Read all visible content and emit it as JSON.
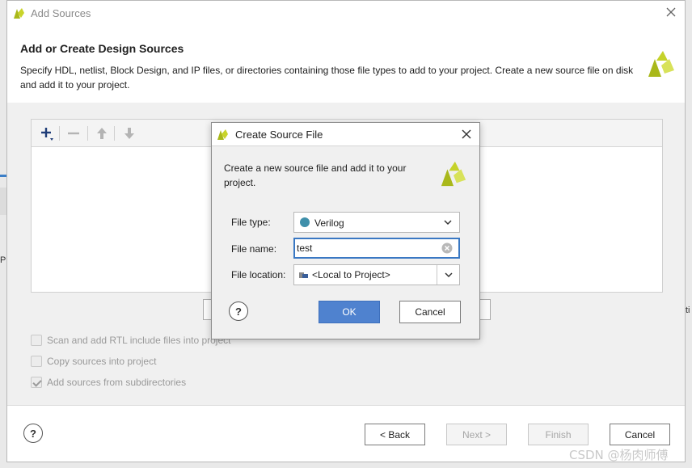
{
  "window": {
    "title": "Add Sources",
    "heading": "Add or Create Design Sources",
    "description": "Specify HDL, netlist, Block Design, and IP files, or directories containing those file types to add to your project. Create a new source file on disk and add it to your project."
  },
  "options": [
    {
      "label": "Scan and add RTL include files into project",
      "checked": false
    },
    {
      "label": "Copy sources into project",
      "checked": false
    },
    {
      "label": "Add sources from subdirectories",
      "checked": true
    }
  ],
  "footer": {
    "back": "< Back",
    "next": "Next >",
    "finish": "Finish",
    "cancel": "Cancel",
    "help": "?"
  },
  "dialog": {
    "title": "Create Source File",
    "description": "Create a new source file and add it to your project.",
    "file_type_label": "File type:",
    "file_type_value": "Verilog",
    "file_name_label": "File name:",
    "file_name_value": "test",
    "file_location_label": "File location:",
    "file_location_value": "<Local to Project>",
    "ok": "OK",
    "cancel": "Cancel",
    "help": "?"
  },
  "background_fragments": {
    "left_text": "P",
    "right_text": "ti"
  },
  "watermark": "CSDN @杨肉师傅",
  "colors": {
    "accent": "#4f82cf",
    "focus_border": "#3a78c3",
    "verilog_dot": "#3f8faa",
    "logo": "#a9b81a"
  }
}
